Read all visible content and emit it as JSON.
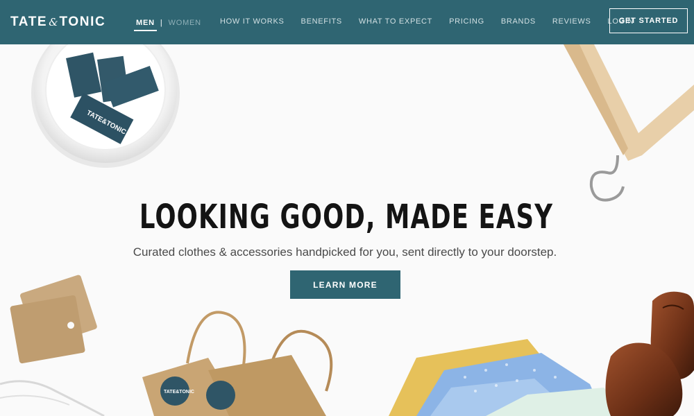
{
  "header": {
    "logo": {
      "left": "TATE",
      "amp": "&",
      "right": "TONIC"
    },
    "gender": {
      "men": "MEN",
      "separator": "|",
      "women": "WOMEN"
    },
    "nav": [
      "HOW IT WORKS",
      "BENEFITS",
      "WHAT TO EXPECT",
      "PRICING",
      "BRANDS",
      "REVIEWS",
      "LOGIN"
    ],
    "cta_label": "GET STARTED"
  },
  "hero": {
    "headline": "LOOKING GOOD, MADE EASY",
    "subline": "Curated clothes & accessories handpicked for you, sent directly to your doorstep.",
    "button_label": "LEARN MORE",
    "tag_text": "TATE&TONIC",
    "sticker_text": "TATE&TONIC"
  },
  "colors": {
    "brand_teal": "#2f6572",
    "nav_text": "#d2e0e3",
    "headline": "#141414",
    "subline": "#4a4a4a"
  }
}
